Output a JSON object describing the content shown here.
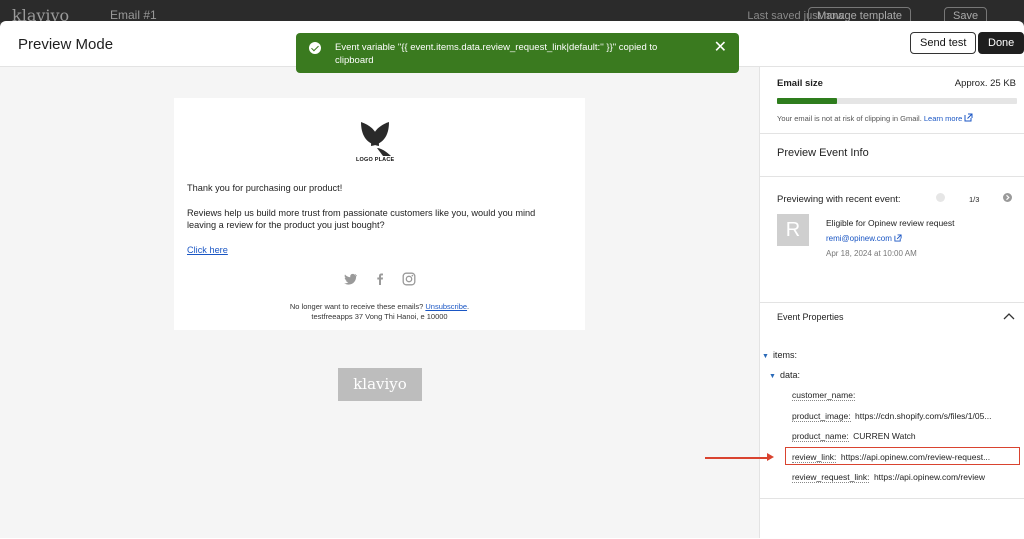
{
  "background": {
    "logo": "klaviyo",
    "email_title": "Email #1",
    "last_saved": "Last saved just now",
    "manage_template": "Manage template",
    "save": "Save"
  },
  "header": {
    "title": "Preview Mode",
    "send_test_label": "Send test",
    "done_label": "Done"
  },
  "toast": {
    "message": "Event variable \"{{ event.items.data.review_request_link|default:'' }}\" copied to clipboard",
    "close_icon": "close-icon",
    "color": "#3a7a1f"
  },
  "email": {
    "logo_text": "LOGO PLACE",
    "line1": "Thank you for purchasing our product!",
    "line2": "Reviews help us build more trust from passionate customers like you, would you mind",
    "line3": "leaving a review for the product you just bought?",
    "cta_link": "Click here",
    "social_icons": [
      "twitter-icon",
      "facebook-icon",
      "instagram-icon"
    ],
    "unsubscribe_prefix": "No longer want to receive these emails?",
    "unsubscribe_link": "Unsubscribe",
    "address": "testfreeapps 37 Vong Thi Hanoi, e 10000",
    "badge": "klaviyo"
  },
  "panel": {
    "email_size": {
      "label": "Email size",
      "value": "Approx. 25 KB",
      "progress": 0.25,
      "note": "Your email is not at risk of clipping in Gmail.",
      "learn_more": "Learn more"
    },
    "event_info_title": "Preview Event Info",
    "previewing": {
      "label": "Previewing with recent event:",
      "pager": "1/3",
      "avatar_letter": "R",
      "event_name": "Eligible for Opinew review request",
      "email": "remi@opinew.com",
      "date": "Apr 18, 2024 at 10:00 AM"
    },
    "event_properties": {
      "title": "Event Properties",
      "items_key": "items:",
      "data_key": "data:",
      "fields": [
        {
          "key": "customer_name:",
          "value": ""
        },
        {
          "key": "product_image:",
          "value": "https://cdn.shopify.com/s/files/1/05..."
        },
        {
          "key": "product_name:",
          "value": "CURREN Watch"
        },
        {
          "key": "review_link:",
          "value": "https://api.opinew.com/review-request..."
        },
        {
          "key": "review_request_link:",
          "value": "https://api.opinew.com/review"
        }
      ]
    }
  }
}
